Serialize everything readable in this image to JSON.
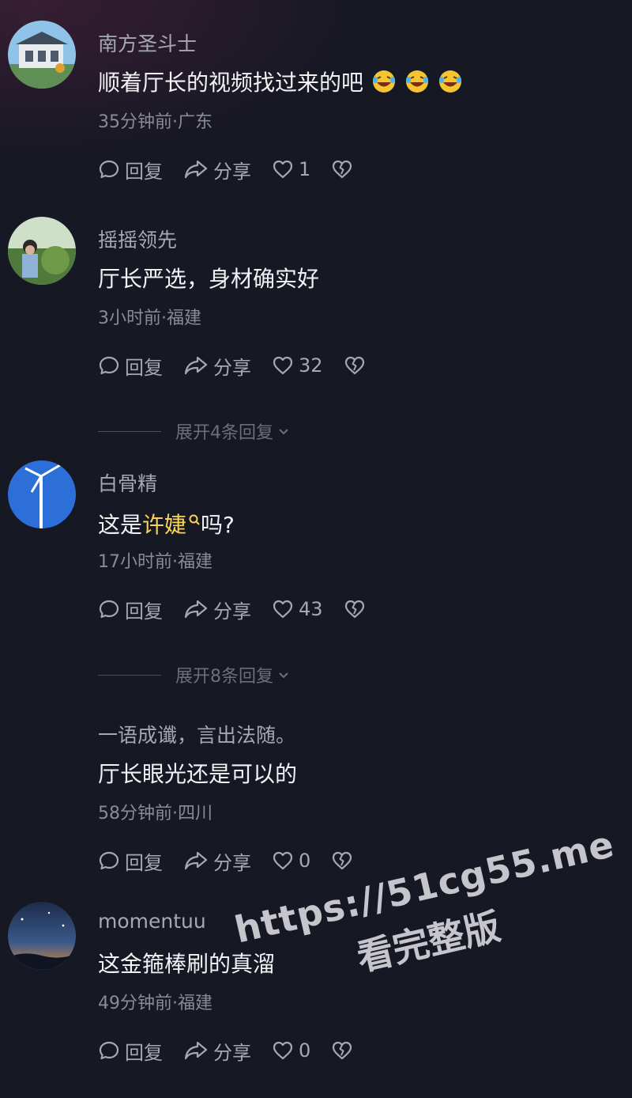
{
  "comments": [
    {
      "username": "南方圣斗士",
      "text": "顺着厅长的视频找过来的吧",
      "emojis": [
        "🤣",
        "🤣",
        "🤣"
      ],
      "meta": "35分钟前·广东",
      "reply_label": "回复",
      "share_label": "分享",
      "like_count": "1"
    },
    {
      "username": "摇摇领先",
      "text": "厅长严选，身材确实好",
      "meta": "3小时前·福建",
      "reply_label": "回复",
      "share_label": "分享",
      "like_count": "32",
      "expand_label": "展开4条回复"
    },
    {
      "username": "白骨精",
      "text_prefix": "这是",
      "text_highlight": "许婕",
      "text_suffix": "吗?",
      "meta": "17小时前·福建",
      "reply_label": "回复",
      "share_label": "分享",
      "like_count": "43",
      "expand_label": "展开8条回复"
    },
    {
      "username": "一语成谶，言出法随。",
      "text": "厅长眼光还是可以的",
      "meta": "58分钟前·四川",
      "reply_label": "回复",
      "share_label": "分享",
      "like_count": "0"
    },
    {
      "username": "momentuu",
      "text": "这金箍棒刷的真溜",
      "meta": "49分钟前·福建",
      "reply_label": "回复",
      "share_label": "分享",
      "like_count": "0"
    }
  ],
  "watermark": {
    "url": "https://51cg55.me",
    "subtitle": "看完整版"
  },
  "colors": {
    "background": "#161823",
    "username": "#a6a8b1",
    "text": "#f2f2f4",
    "meta": "#8a8c95",
    "highlight": "#f7d35a"
  }
}
